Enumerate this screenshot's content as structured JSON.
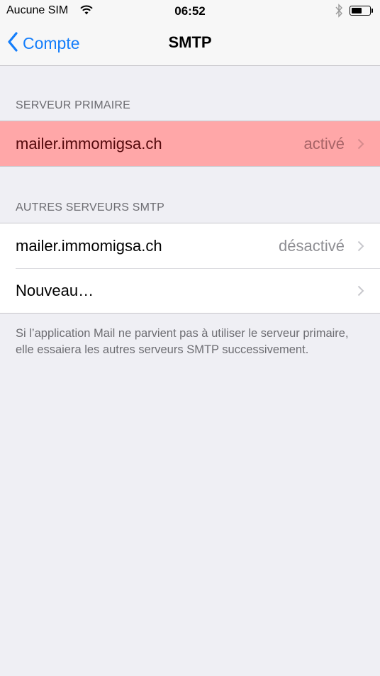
{
  "status_bar": {
    "carrier": "Aucune SIM",
    "time": "06:52",
    "wifi_icon": "wifi-icon",
    "bluetooth_icon": "bluetooth-icon",
    "battery_level": 0.6
  },
  "nav": {
    "back_label": "Compte",
    "title": "SMTP"
  },
  "sections": {
    "primary": {
      "header": "SERVEUR PRIMAIRE",
      "rows": [
        {
          "title": "mailer.immomigsa.ch",
          "detail": "activé",
          "highlighted": true
        }
      ]
    },
    "others": {
      "header": "AUTRES SERVEURS SMTP",
      "rows": [
        {
          "title": "mailer.immomigsa.ch",
          "detail": "désactivé"
        },
        {
          "title": "Nouveau…",
          "detail": ""
        }
      ]
    }
  },
  "footer_text": "Si l’application Mail ne parvient pas à utiliser le serveur primaire, elle essaiera les autres serveurs SMTP successivement.",
  "colors": {
    "accent": "#147efb",
    "highlight": "#ffa7a8",
    "background": "#efeff4"
  }
}
